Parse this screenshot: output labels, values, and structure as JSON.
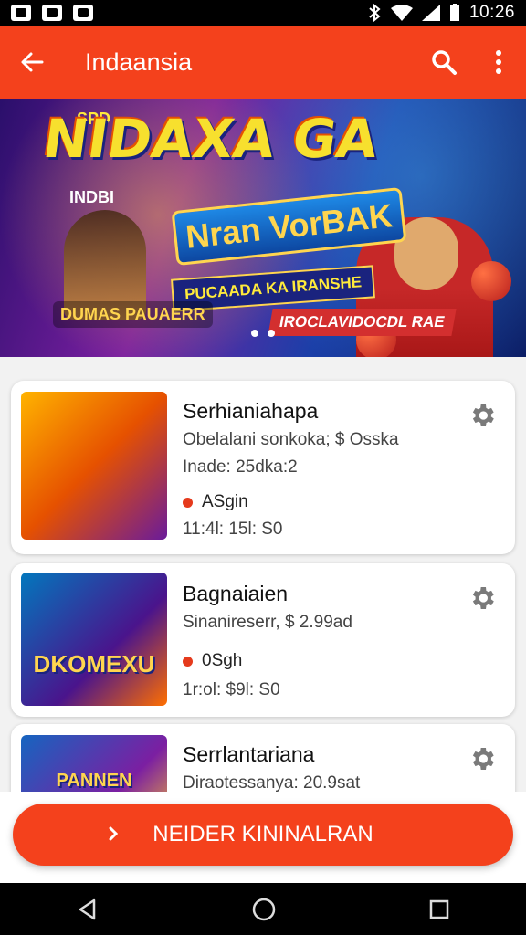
{
  "status_bar": {
    "time": "10:26"
  },
  "app_bar": {
    "title": "Indaansia"
  },
  "banner": {
    "tag": "SPD",
    "title": "NIDAXA GA",
    "subtitle": "INDBI",
    "logo_text": "Nran VorBAK",
    "ribbon": "PUCAADA KA IRANSHE",
    "badge": "DUMAS PAUAERR",
    "promo": "IROCLAVIDOCDL RAE",
    "slide_count": 2
  },
  "items": [
    {
      "name": "Serhianiahapa",
      "desc": "Obelalani sonkoka; $ Osska",
      "meta": "Inade: 25dka:2",
      "status": "ASgin",
      "time": "11:4l: 15l: S0",
      "thumb_text": ""
    },
    {
      "name": "Bagnaiaien",
      "desc": "Sinanireserr, $ 2.99ad",
      "meta": "",
      "status": "0Sgh",
      "time": "1r:ol: $9l: S0",
      "thumb_text": "DKOMEXU"
    },
    {
      "name": "Serrlantariana",
      "desc": "Diraotessanya: 20.9sat",
      "meta": "",
      "status": "",
      "time": "",
      "thumb_text": "PANNEN"
    }
  ],
  "cta": {
    "label": "NEIDER KININALRAN"
  },
  "colors": {
    "primary": "#F4411C",
    "list_bg": "#F2F2F2",
    "status_dot": "#E53A1C"
  }
}
